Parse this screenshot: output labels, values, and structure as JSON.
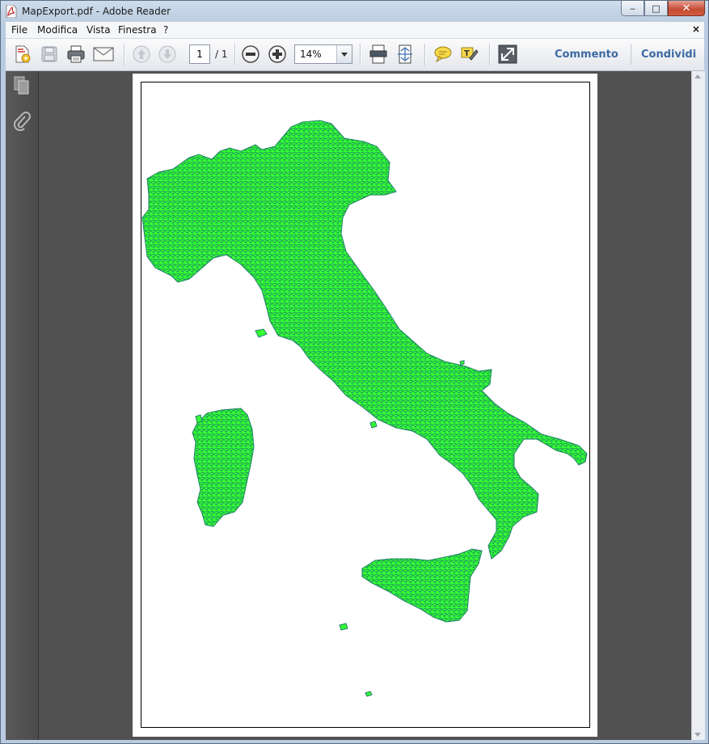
{
  "window": {
    "title": "MapExport.pdf - Adobe Reader",
    "controls": {
      "minimize": "‒",
      "maximize": "□",
      "close": "✕"
    }
  },
  "menubar": {
    "items": [
      "File",
      "Modifica",
      "Vista",
      "Finestra",
      "?"
    ],
    "close_doc": "×"
  },
  "toolbar": {
    "page_current": "1",
    "page_total": "/ 1",
    "zoom": "14%",
    "links": {
      "comment": "Commento",
      "share": "Condividi"
    },
    "icons": [
      "create-pdf-icon",
      "save-icon",
      "print-icon",
      "email-icon",
      "previous-page-icon",
      "next-page-icon",
      "zoom-out-icon",
      "zoom-in-icon",
      "fit-page-icon",
      "fit-width-icon",
      "comment-note-icon",
      "highlight-text-icon",
      "fullscreen-icon"
    ]
  },
  "left_panel": {
    "icons": [
      "pages-icon",
      "attachments-icon"
    ]
  },
  "document": {
    "content": "map-of-italy-municipalities",
    "colors": {
      "fill": "#33ff33",
      "border": "#1f7f66",
      "page": "#ffffff",
      "background": "#515151"
    }
  }
}
